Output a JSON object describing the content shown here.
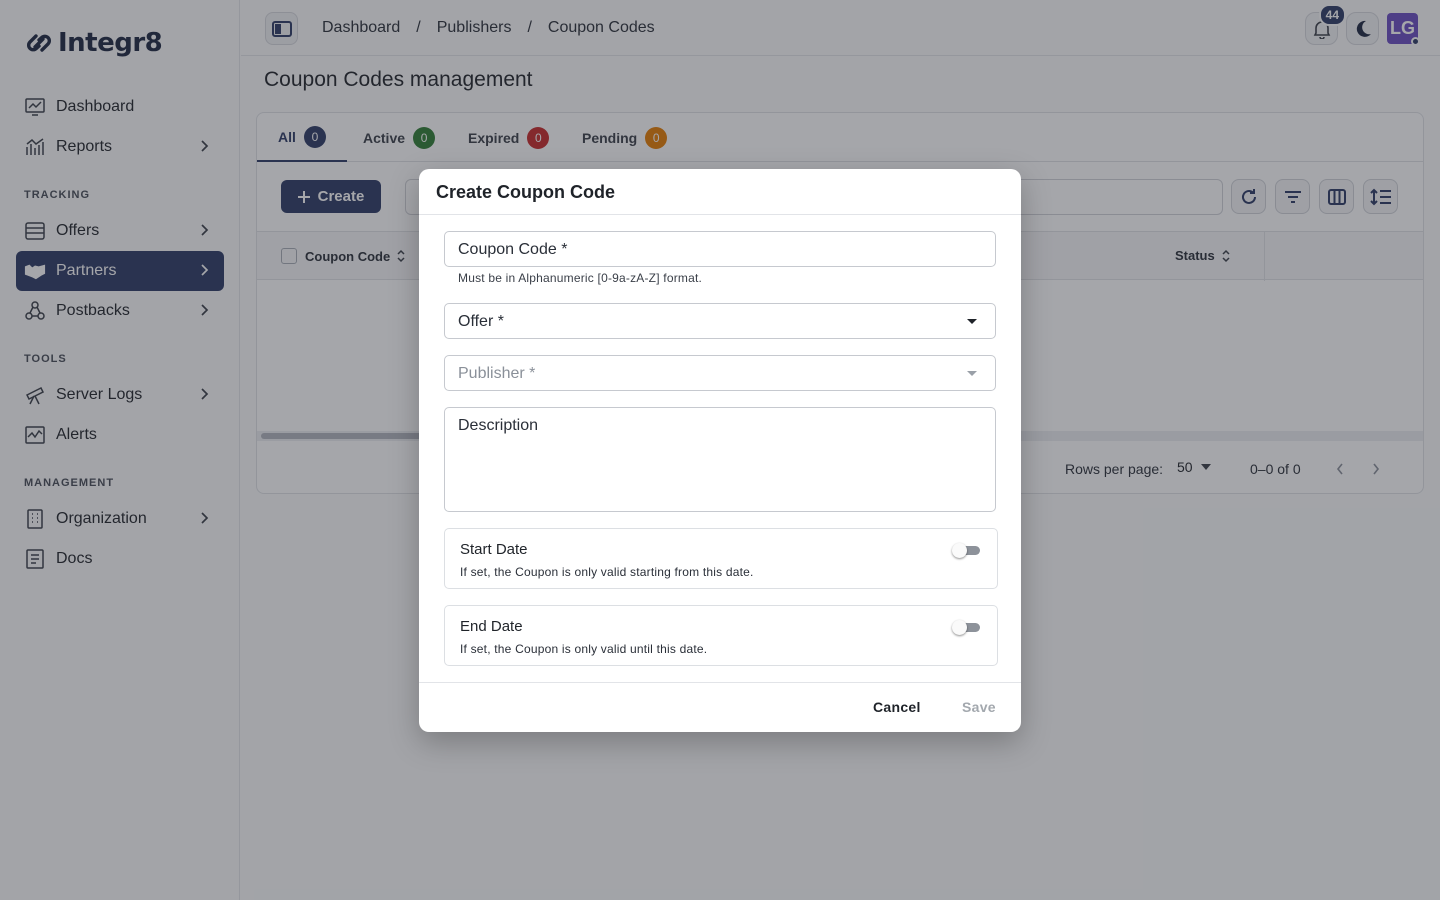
{
  "app": {
    "logo_text": "Integr8"
  },
  "sidebar": {
    "items": [
      {
        "label": "Dashboard",
        "icon": "dashboard-icon"
      },
      {
        "label": "Reports",
        "icon": "chart-icon"
      },
      {
        "label": "Offers",
        "icon": "offers-icon"
      },
      {
        "label": "Partners",
        "icon": "handshake-icon"
      },
      {
        "label": "Postbacks",
        "icon": "webhook-icon"
      },
      {
        "label": "Server Logs",
        "icon": "telescope-icon"
      },
      {
        "label": "Alerts",
        "icon": "alert-chart-icon"
      },
      {
        "label": "Organization",
        "icon": "building-icon"
      },
      {
        "label": "Docs",
        "icon": "docs-icon"
      }
    ],
    "sections": {
      "tracking": "TRACKING",
      "tools": "TOOLS",
      "management": "MANAGEMENT"
    }
  },
  "header": {
    "breadcrumb": [
      "Dashboard",
      "Publishers",
      "Coupon Codes"
    ],
    "separator": "/",
    "notifications_count": "44",
    "avatar_initials": "LG"
  },
  "main": {
    "title": "Coupon Codes management",
    "tabs": [
      {
        "label": "All",
        "count": "0",
        "color": "#2c3a64"
      },
      {
        "label": "Active",
        "count": "0",
        "color": "#2e7d32"
      },
      {
        "label": "Expired",
        "count": "0",
        "color": "#c62828"
      },
      {
        "label": "Pending",
        "count": "0",
        "color": "#e67c00"
      }
    ],
    "create_label": "Create",
    "columns": {
      "coupon_code": "Coupon Code",
      "status": "Status"
    },
    "pagination": {
      "rows_label": "Rows per page:",
      "rows_value": "50",
      "range": "0–0 of 0"
    }
  },
  "modal": {
    "title": "Create Coupon Code",
    "coupon_code_label": "Coupon Code *",
    "coupon_code_helper": "Must be in Alphanumeric [0-9a-zA-Z] format.",
    "offer_label": "Offer *",
    "publisher_label": "Publisher *",
    "description_label": "Description",
    "start_date": {
      "title": "Start Date",
      "desc": "If set, the Coupon is only valid starting from this date."
    },
    "end_date": {
      "title": "End Date",
      "desc": "If set, the Coupon is only valid until this date."
    },
    "cancel_label": "Cancel",
    "save_label": "Save"
  }
}
